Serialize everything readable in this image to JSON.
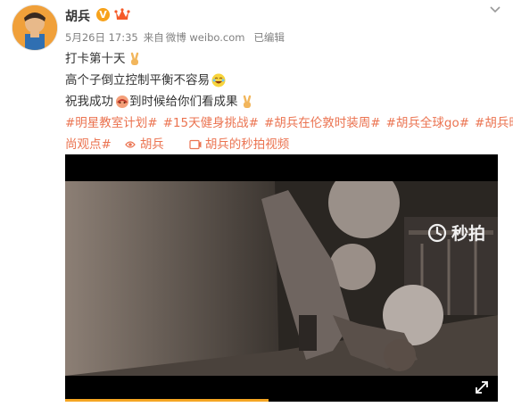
{
  "post": {
    "author": "胡兵",
    "verified_mark": "V",
    "timestamp": "5月26日 17:35",
    "source_prefix": "来自",
    "source": "微博 weibo.com",
    "edited": "已编辑",
    "lines": [
      "打卡第十天",
      "高个子倒立控制平衡不容易",
      "祝我成功",
      "到时候给你们看成果"
    ],
    "topics": [
      "#明星教室计划#",
      "#15天健身挑战#",
      "#胡兵在伦敦时装周#",
      "#胡兵全球go#",
      "#胡兵时",
      "尚观点#"
    ],
    "location_link": "胡兵",
    "video_link": "胡兵的秒拍视频"
  },
  "video": {
    "watermark": "秒拍",
    "progress": 0.47
  },
  "colors": {
    "topic": "#eb7350",
    "meta": "#808080",
    "progress": "#f5a623"
  },
  "icons": [
    "avatar",
    "verified-icon",
    "crown-icon",
    "more-icon",
    "victory-hand-emoji",
    "laugh-emoji",
    "wish-emoji",
    "location-icon",
    "video-icon",
    "miaopai-logo-icon",
    "fullscreen-icon"
  ]
}
